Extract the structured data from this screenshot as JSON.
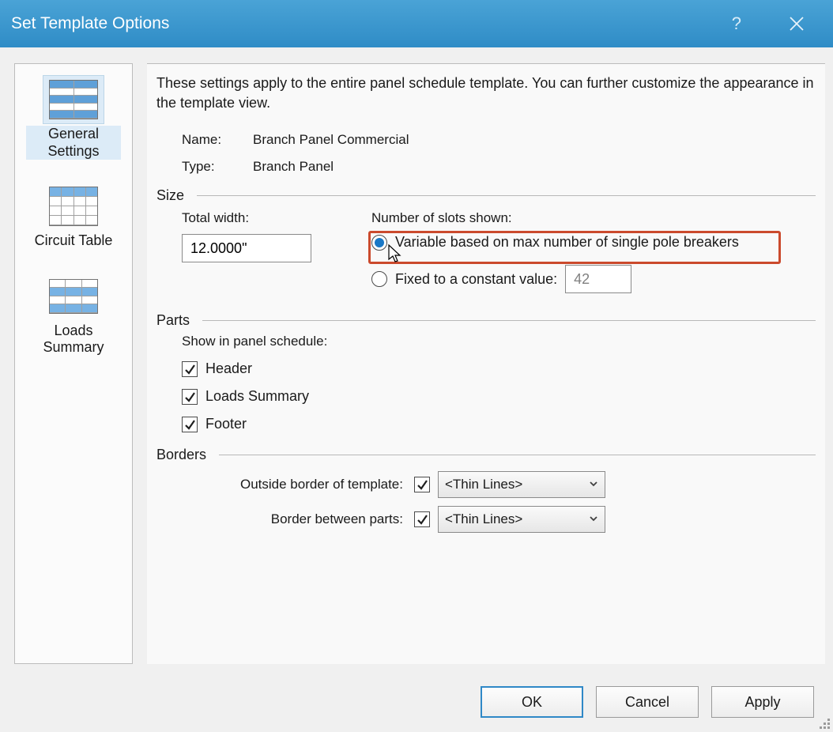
{
  "title": "Set Template Options",
  "sidebar": {
    "items": [
      {
        "label": "General Settings"
      },
      {
        "label": "Circuit Table"
      },
      {
        "label": "Loads Summary"
      }
    ]
  },
  "intro": "These settings apply to the entire panel schedule template. You can further customize the appearance in the template view.",
  "name_label": "Name:",
  "name_value": "Branch Panel Commercial",
  "type_label": "Type:",
  "type_value": "Branch Panel",
  "size": {
    "head": "Size",
    "total_width_label": "Total width:",
    "total_width_value": "12.0000\"",
    "slots_label": "Number of slots shown:",
    "radio_variable": "Variable based on max number of single pole breakers",
    "radio_fixed": "Fixed to a constant value:",
    "fixed_value": "42"
  },
  "parts": {
    "head": "Parts",
    "show_label": "Show in panel schedule:",
    "header": "Header",
    "loads_summary": "Loads Summary",
    "footer": "Footer"
  },
  "borders": {
    "head": "Borders",
    "outside_label": "Outside border of template:",
    "between_label": "Border between parts:",
    "style": "<Thin Lines>"
  },
  "buttons": {
    "ok": "OK",
    "cancel": "Cancel",
    "apply": "Apply"
  }
}
